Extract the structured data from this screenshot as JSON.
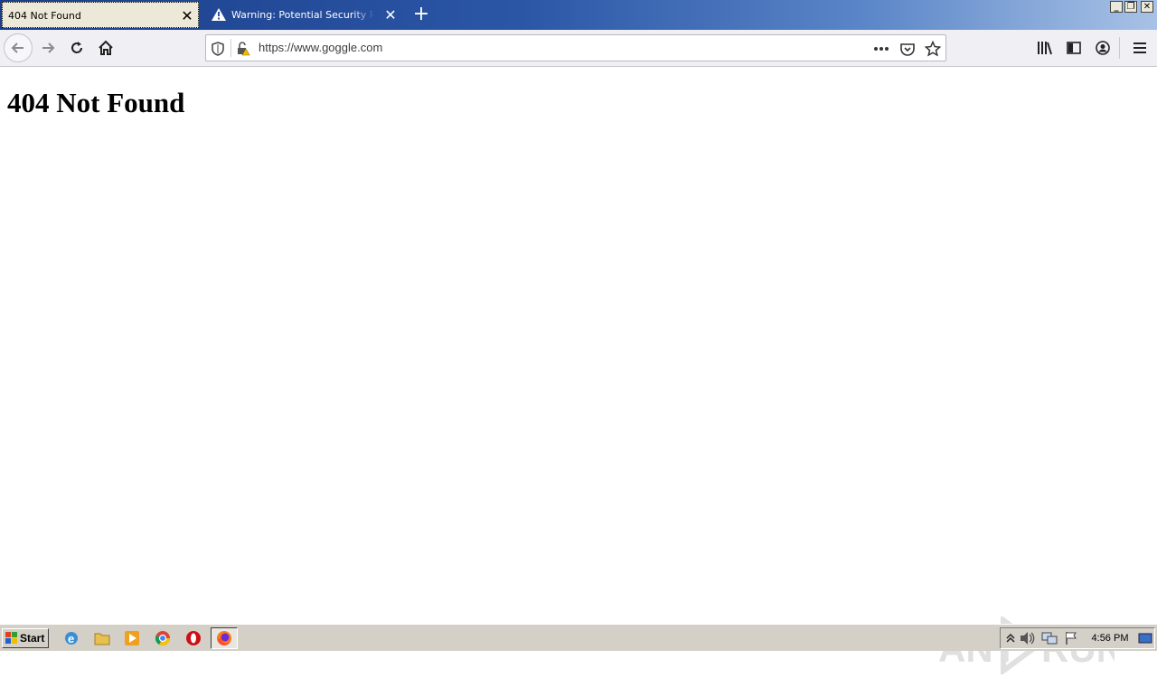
{
  "browser": {
    "tabs": [
      {
        "title": "404 Not Found",
        "active": true
      },
      {
        "title": "Warning: Potential Security Risk Ahead",
        "active": false
      }
    ],
    "url": "https://www.goggle.com"
  },
  "page": {
    "heading": "404 Not Found"
  },
  "taskbar": {
    "start_label": "Start",
    "clock": "4:56 PM"
  },
  "watermark": "ANY RUN",
  "colors": {
    "titlebar_start": "#1b3f8a",
    "titlebar_end": "#a8c2e6",
    "toolbar_bg": "#f0f0f4",
    "taskbar_bg": "#d4d0c8"
  }
}
